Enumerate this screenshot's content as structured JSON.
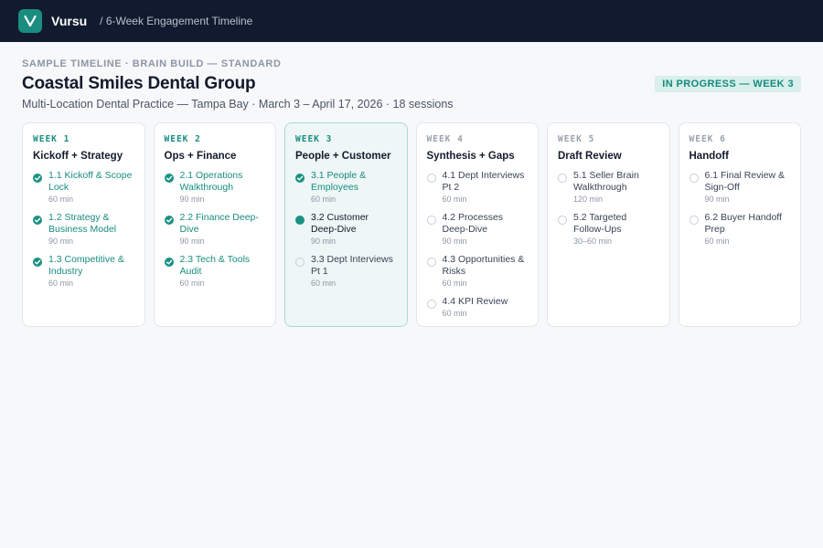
{
  "topbar": {
    "logo_letter": "V",
    "brand": "Vursu",
    "breadcrumb": "/ 6-Week Engagement Timeline"
  },
  "header": {
    "eyebrow": "SAMPLE TIMELINE · BRAIN BUILD — STANDARD",
    "title": "Coastal Smiles Dental Group",
    "subtitle": "Multi-Location Dental Practice — Tampa Bay · March 3 – April 17, 2026 · 18 sessions",
    "status": "IN PROGRESS — WEEK 3"
  },
  "colors": {
    "accent": "#1a9283",
    "topbar": "#111a2e",
    "status_bg": "#d8efec"
  },
  "weeks": [
    {
      "label": "WEEK 1",
      "title": "Kickoff + Strategy",
      "state": "done",
      "sessions": [
        {
          "name": "1.1 Kickoff & Scope Lock",
          "duration": "60 min",
          "status": "done"
        },
        {
          "name": "1.2 Strategy & Business Model",
          "duration": "90 min",
          "status": "done"
        },
        {
          "name": "1.3 Competitive & Industry",
          "duration": "60 min",
          "status": "done"
        }
      ]
    },
    {
      "label": "WEEK 2",
      "title": "Ops + Finance",
      "state": "done",
      "sessions": [
        {
          "name": "2.1 Operations Walkthrough",
          "duration": "90 min",
          "status": "done"
        },
        {
          "name": "2.2 Finance Deep-Dive",
          "duration": "90 min",
          "status": "done"
        },
        {
          "name": "2.3 Tech & Tools Audit",
          "duration": "60 min",
          "status": "done"
        }
      ]
    },
    {
      "label": "WEEK 3",
      "title": "People + Customer",
      "state": "current",
      "sessions": [
        {
          "name": "3.1 People & Employees",
          "duration": "60 min",
          "status": "done"
        },
        {
          "name": "3.2 Customer Deep-Dive",
          "duration": "90 min",
          "status": "active"
        },
        {
          "name": "3.3 Dept Interviews Pt 1",
          "duration": "60 min",
          "status": "todo"
        }
      ]
    },
    {
      "label": "WEEK 4",
      "title": "Synthesis + Gaps",
      "state": "upcoming",
      "sessions": [
        {
          "name": "4.1 Dept Interviews Pt 2",
          "duration": "60 min",
          "status": "todo"
        },
        {
          "name": "4.2 Processes Deep-Dive",
          "duration": "90 min",
          "status": "todo"
        },
        {
          "name": "4.3 Opportunities & Risks",
          "duration": "60 min",
          "status": "todo"
        },
        {
          "name": "4.4 KPI Review",
          "duration": "60 min",
          "status": "todo"
        }
      ]
    },
    {
      "label": "WEEK 5",
      "title": "Draft Review",
      "state": "upcoming",
      "sessions": [
        {
          "name": "5.1 Seller Brain Walkthrough",
          "duration": "120 min",
          "status": "todo"
        },
        {
          "name": "5.2 Targeted Follow-Ups",
          "duration": "30–60 min",
          "status": "todo"
        }
      ]
    },
    {
      "label": "WEEK 6",
      "title": "Handoff",
      "state": "upcoming",
      "sessions": [
        {
          "name": "6.1 Final Review & Sign-Off",
          "duration": "90 min",
          "status": "todo"
        },
        {
          "name": "6.2 Buyer Handoff Prep",
          "duration": "60 min",
          "status": "todo"
        }
      ]
    }
  ]
}
